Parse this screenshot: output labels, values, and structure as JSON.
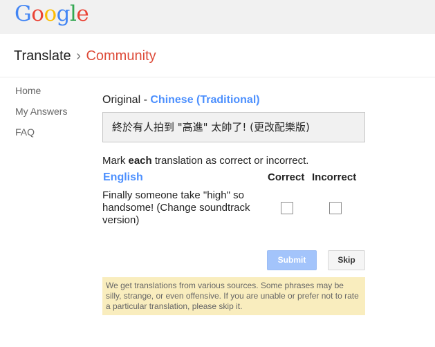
{
  "header": {
    "logo_letters": [
      "G",
      "o",
      "o",
      "g",
      "l",
      "e"
    ]
  },
  "breadcrumb": {
    "product": "Translate",
    "separator": "›",
    "section": "Community"
  },
  "sidebar": {
    "items": [
      {
        "label": "Home"
      },
      {
        "label": "My Answers"
      },
      {
        "label": "FAQ"
      }
    ]
  },
  "main": {
    "original_prefix": "Original - ",
    "original_language": "Chinese (Traditional)",
    "source_text": "終於有人拍到 \"高進\" 太帥了! (更改配樂版)",
    "instruction_prefix": "Mark ",
    "instruction_bold": "each",
    "instruction_suffix": " translation as correct or incorrect.",
    "target_language": "English",
    "correct_header": "Correct",
    "incorrect_header": "Incorrect",
    "translation_text": "Finally someone take \"high\" so handsome! (Change soundtrack version)",
    "correct_checked": false,
    "incorrect_checked": false,
    "submit_label": "Submit",
    "skip_label": "Skip",
    "notice_text": "We get translations from various sources. Some phrases may be silly, strange, or even offensive. If you are unable or prefer not to rate a particular translation, please skip it."
  },
  "colors": {
    "accent_blue": "#4d90fe",
    "community_red": "#dd4b39",
    "notice_bg": "#f9edbe",
    "submit_bg": "#a3c4fb"
  }
}
